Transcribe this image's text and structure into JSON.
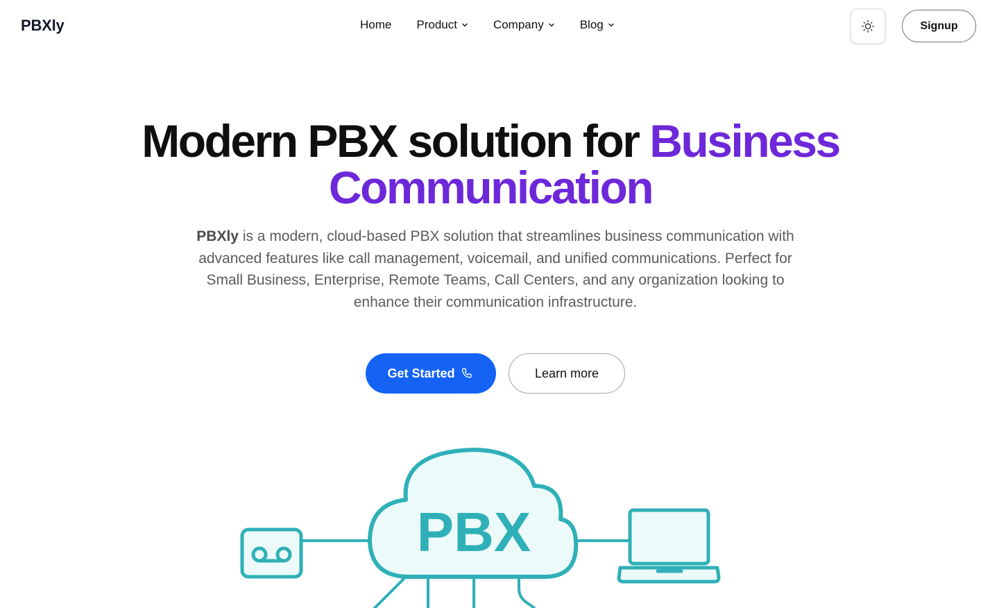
{
  "header": {
    "logo": "PBXly",
    "nav": [
      {
        "label": "Home",
        "has_dropdown": false
      },
      {
        "label": "Product",
        "has_dropdown": true
      },
      {
        "label": "Company",
        "has_dropdown": true
      },
      {
        "label": "Blog",
        "has_dropdown": true
      }
    ],
    "theme_toggle_icon": "sun-icon",
    "signup_label": "Signup"
  },
  "hero": {
    "title_main": "Modern PBX solution for ",
    "title_accent_1": "Business",
    "title_accent_2": "Communication",
    "desc_brand": "PBXly",
    "desc_rest": " is a modern, cloud-based PBX solution that streamlines business communication with advanced features like call management, voicemail, and unified communications. Perfect for Small Business, Enterprise, Remote Teams, Call Centers, and any organization looking to enhance their communication infrastructure.",
    "cta_primary": "Get Started",
    "cta_primary_icon": "phone-icon",
    "cta_secondary": "Learn more"
  },
  "illustration": {
    "cloud_label": "PBX",
    "left_icon": "voicemail-icon",
    "right_icon": "laptop-icon"
  },
  "colors": {
    "accent_purple": "#6d28d9",
    "primary_blue": "#1463f5",
    "teal": "#2fb0b8",
    "teal_fill": "#ecfbfa"
  }
}
